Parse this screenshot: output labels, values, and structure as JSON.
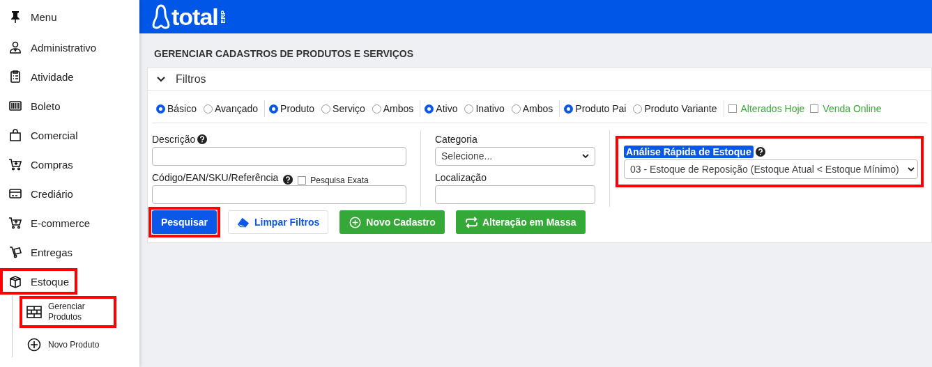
{
  "sidebar": {
    "title": "Menu",
    "items": [
      {
        "label": "Administrativo",
        "highlighted": false
      },
      {
        "label": "Atividade",
        "highlighted": false
      },
      {
        "label": "Boleto",
        "highlighted": false
      },
      {
        "label": "Comercial",
        "highlighted": false
      },
      {
        "label": "Compras",
        "highlighted": false
      },
      {
        "label": "Crediário",
        "highlighted": false
      },
      {
        "label": "E-commerce",
        "highlighted": false
      },
      {
        "label": "Entregas",
        "highlighted": false
      },
      {
        "label": "Estoque",
        "highlighted": true,
        "expanded": true,
        "children": [
          {
            "label": "Gerenciar Produtos",
            "highlighted": true
          },
          {
            "label": "Novo Produto",
            "highlighted": false
          }
        ]
      }
    ]
  },
  "header": {
    "logo": "total",
    "logo_suffix": "ERP"
  },
  "page_title": "GERENCIAR CADASTROS DE PRODUTOS E SERVIÇOS",
  "filters": {
    "title": "Filtros",
    "expanded": true,
    "radio_groups": [
      [
        {
          "label": "Básico",
          "selected": true
        },
        {
          "label": "Avançado",
          "selected": false
        }
      ],
      [
        {
          "label": "Produto",
          "selected": true
        },
        {
          "label": "Serviço",
          "selected": false
        },
        {
          "label": "Ambos",
          "selected": false
        }
      ],
      [
        {
          "label": "Ativo",
          "selected": true
        },
        {
          "label": "Inativo",
          "selected": false
        },
        {
          "label": "Ambos",
          "selected": false
        }
      ],
      [
        {
          "label": "Produto Pai",
          "selected": true
        },
        {
          "label": "Produto Variante",
          "selected": false
        }
      ]
    ],
    "checkboxes": [
      {
        "label": "Alterados Hoje",
        "checked": false
      },
      {
        "label": "Venda Online",
        "checked": false
      }
    ],
    "description_label": "Descrição",
    "code_label": "Código/EAN/SKU/Referência",
    "exact_search": {
      "label": "Pesquisa Exata",
      "checked": false
    },
    "category_label": "Categoria",
    "category_value": "Selecione...",
    "location_label": "Localização",
    "analysis": {
      "label": "Análise Rápida de Estoque",
      "value": "03 - Estoque de Reposição (Estoque Atual < Estoque Mínimo)",
      "highlighted": true
    },
    "buttons": [
      {
        "label": "Pesquisar",
        "kind": "primary",
        "highlighted": true
      },
      {
        "label": "Limpar Filtros",
        "kind": "clear",
        "highlighted": false
      },
      {
        "label": "Novo Cadastro",
        "kind": "new",
        "highlighted": false
      },
      {
        "label": "Alteração em Massa",
        "kind": "bulk",
        "highlighted": false
      }
    ]
  }
}
